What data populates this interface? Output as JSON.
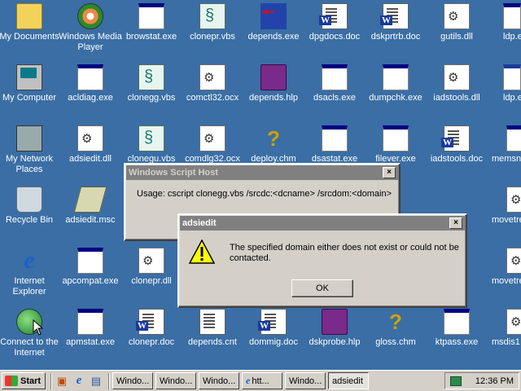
{
  "desktop": {
    "icons": [
      {
        "label": "My Documents",
        "icon": "folder-icon"
      },
      {
        "label": "Windows Media Player",
        "icon": "media-player-icon"
      },
      {
        "label": "browstat.exe",
        "icon": "exe-icon"
      },
      {
        "label": "clonepr.vbs",
        "icon": "script-icon"
      },
      {
        "label": "depends.exe",
        "icon": "depends-icon"
      },
      {
        "label": "dpgdocs.doc",
        "icon": "word-doc-icon"
      },
      {
        "label": "dskprtrb.doc",
        "icon": "word-doc-icon"
      },
      {
        "label": "gutils.dll",
        "icon": "dll-icon"
      },
      {
        "label": "ldp.e",
        "icon": "exe-icon"
      },
      {
        "label": "My Computer",
        "icon": "computer-icon"
      },
      {
        "label": "acldiag.exe",
        "icon": "exe-icon"
      },
      {
        "label": "clonegg.vbs",
        "icon": "script-icon"
      },
      {
        "label": "comctl32.ocx",
        "icon": "dll-icon"
      },
      {
        "label": "depends.hlp",
        "icon": "help-book-icon"
      },
      {
        "label": "dsacls.exe",
        "icon": "exe-icon"
      },
      {
        "label": "dumpchk.exe",
        "icon": "exe-icon"
      },
      {
        "label": "iadstools.dll",
        "icon": "dll-icon"
      },
      {
        "label": "ldp.e",
        "icon": "exe-icon"
      },
      {
        "label": "My Network Places",
        "icon": "network-icon"
      },
      {
        "label": "adsiedit.dll",
        "icon": "dll-icon"
      },
      {
        "label": "clonegu.vbs",
        "icon": "script-icon"
      },
      {
        "label": "comdlg32.ocx",
        "icon": "dll-icon"
      },
      {
        "label": "deploy.chm",
        "icon": "help-icon"
      },
      {
        "label": "dsastat.exe",
        "icon": "exe-icon"
      },
      {
        "label": "filever.exe",
        "icon": "exe-icon"
      },
      {
        "label": "iadstools.doc",
        "icon": "word-doc-icon"
      },
      {
        "label": "memsna",
        "icon": "exe-icon"
      },
      {
        "label": "Recycle Bin",
        "icon": "recycle-bin-icon"
      },
      {
        "label": "adsiedit.msc",
        "icon": "msc-icon"
      },
      {
        "label": "movetre",
        "icon": "dll-icon"
      },
      {
        "label": "Internet Explorer",
        "icon": "ie-icon"
      },
      {
        "label": "apcompat.exe",
        "icon": "exe-icon"
      },
      {
        "label": "clonepr.dll",
        "icon": "dll-icon"
      },
      {
        "label": "movetre",
        "icon": "dll-icon"
      },
      {
        "label": "Connect to the Internet",
        "icon": "connect-icon"
      },
      {
        "label": "apmstat.exe",
        "icon": "exe-icon"
      },
      {
        "label": "clonepr.doc",
        "icon": "word-doc-icon"
      },
      {
        "label": "depends.cnt",
        "icon": "doc-icon"
      },
      {
        "label": "dommig.doc",
        "icon": "word-doc-icon"
      },
      {
        "label": "dskprobe.hlp",
        "icon": "help-book-icon"
      },
      {
        "label": "gloss.chm",
        "icon": "help-icon"
      },
      {
        "label": "ktpass.exe",
        "icon": "exe-icon"
      },
      {
        "label": "msdis1",
        "icon": "dll-icon"
      }
    ]
  },
  "wsh_window": {
    "title": "Windows Script Host",
    "message": "Usage: cscript clonegg.vbs /srcdc:<dcname> /srcdom:<domain>",
    "close_label": "×"
  },
  "adsiedit_dialog": {
    "title": "adsiedit",
    "message": "The specified domain either does not exist or could not be contacted.",
    "ok_label": "OK",
    "close_label": "×",
    "icon": "warning-icon"
  },
  "taskbar": {
    "start_label": "Start",
    "buttons": [
      {
        "label": "Windo..."
      },
      {
        "label": "Windo..."
      },
      {
        "label": "Windo..."
      },
      {
        "label": "htt..."
      },
      {
        "label": "Windo..."
      },
      {
        "label": "adsiedit"
      }
    ],
    "clock": "12:36 PM"
  }
}
